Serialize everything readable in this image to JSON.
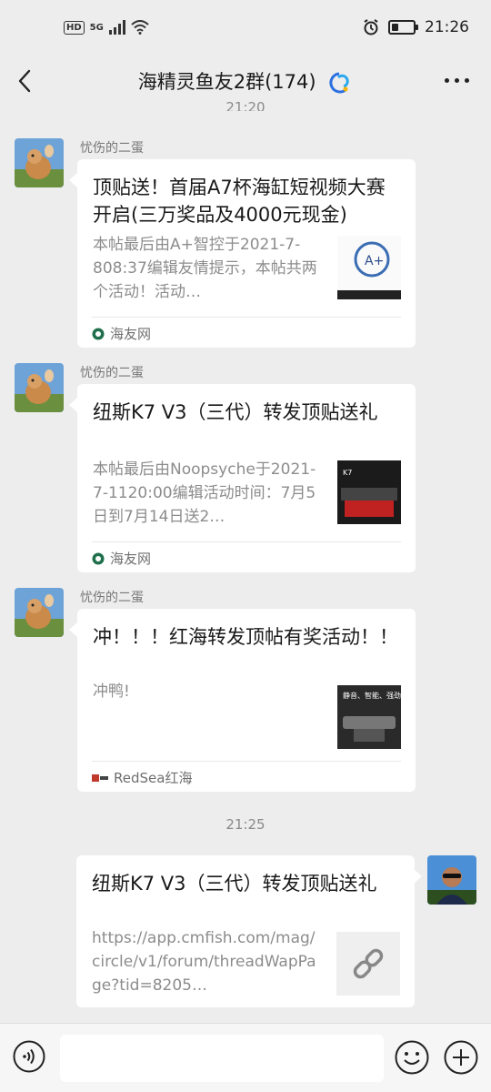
{
  "status_bar": {
    "network": "5G",
    "hd_label": "HD",
    "time": "21:26",
    "battery_level": 0.3
  },
  "nav": {
    "title": "海精灵鱼友2群(174)"
  },
  "timestamps": {
    "top": "21:20",
    "middle": "21:25"
  },
  "messages": [
    {
      "sender": "忧伤的二蛋",
      "title": "顶贴送！首届A7杯海缸短视频大赛开启(三万奖品及4000元现金)",
      "desc": "本帖最后由A+智控于2021-7-808:37编辑友情提示，本帖共两个活动！活动…",
      "source": "海友网"
    },
    {
      "sender": "忧伤的二蛋",
      "title": "纽斯K7 V3（三代）转发顶贴送礼",
      "desc": "本帖最后由Noopsyche于2021-7-1120:00编辑活动时间：7月5日到7月14日送2…",
      "source": "海友网"
    },
    {
      "sender": "忧伤的二蛋",
      "title": "冲！！！红海转发顶帖有奖活动！！",
      "desc": "冲鸭!",
      "source": "RedSea红海"
    },
    {
      "sender": "",
      "title": "纽斯K7 V3（三代）转发顶贴送礼",
      "desc": "https://app.cmfish.com/mag/circle/v1/forum/threadWapPage?tid=8205…",
      "source": ""
    }
  ],
  "thumb_texts": {
    "a7_caption": "A+",
    "k7_label": "K7",
    "redsea_text": "静音、智能、强劲"
  },
  "icons": {
    "back": "back-arrow-icon",
    "more": "more-icon",
    "voice": "voice-icon",
    "emoji": "emoji-icon",
    "plus": "plus-icon",
    "link": "link-icon"
  }
}
